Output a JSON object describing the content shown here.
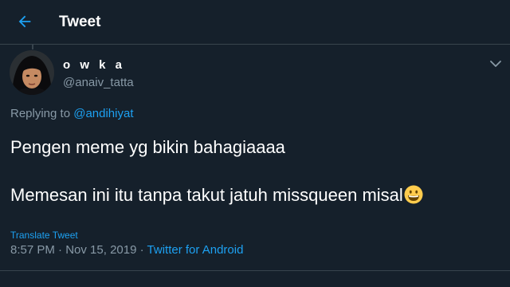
{
  "header": {
    "title": "Tweet"
  },
  "tweet": {
    "author": {
      "display_name": "o w k a",
      "username": "@anaiv_tatta"
    },
    "reply": {
      "prefix": "Replying to",
      "mention": "@andihiyat"
    },
    "text_lines": [
      "Pengen meme yg bikin bahagiaaaa",
      "Memesan ini itu tanpa takut jatuh missqueen misal"
    ],
    "emoji": "grinning-face",
    "translate_label": "Translate Tweet",
    "time": "8:57 PM",
    "sep1": "·",
    "date": "Nov 15, 2019",
    "sep2": "·",
    "source": "Twitter for Android"
  },
  "colors": {
    "background": "#15202b",
    "accent": "#1da1f2",
    "secondary_text": "#8899a6",
    "divider": "#38444d"
  },
  "icons": {
    "back": "arrow-left-icon",
    "menu": "chevron-down-icon"
  }
}
